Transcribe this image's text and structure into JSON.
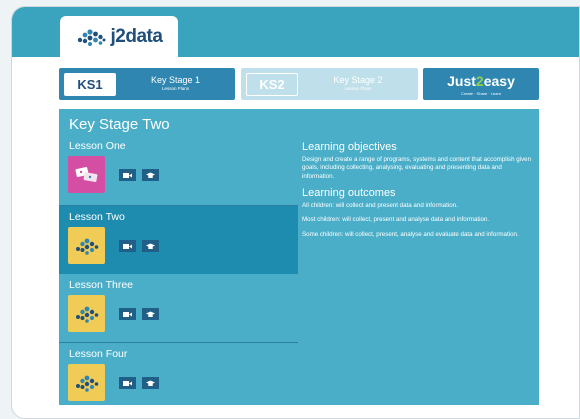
{
  "logo": {
    "text": "j2data",
    "icon": "cloud-dots-logo"
  },
  "stages": [
    {
      "badge": "KS1",
      "title": "Key Stage 1",
      "subtitle": "Lesson Plans"
    },
    {
      "badge": "KS2",
      "title": "Key Stage 2",
      "subtitle": "Lesson Plans"
    }
  ],
  "just2easy": {
    "pre": "Just",
    "two": "2",
    "post": "easy",
    "tagline": "Create · Share · Learn"
  },
  "panel": {
    "title": "Key Stage Two",
    "lessons": [
      {
        "name": "Lesson One",
        "thumb": "pink",
        "active": false
      },
      {
        "name": "Lesson Two",
        "thumb": "yellow",
        "active": true
      },
      {
        "name": "Lesson Three",
        "thumb": "yellow",
        "active": false
      },
      {
        "name": "Lesson Four",
        "thumb": "yellow",
        "active": false
      }
    ],
    "objectives_heading": "Learning objectives",
    "objectives_text": "Design and create a range of programs, systems and content that accomplish given goals, including collecting, analysing, evaluating and presenting data and information.",
    "outcomes_heading": "Learning outcomes",
    "outcome_all": "All children: will collect and present data and information.",
    "outcome_most": "Most children: will collect, present and analyse data and information.",
    "outcome_some": "Some children: will collect, present, analyse and evaluate data and information."
  },
  "colors": {
    "band": "#3aa3bd",
    "panel": "#4aaec8",
    "active": "#1d8cae",
    "stage_active": "#2f86b0"
  }
}
